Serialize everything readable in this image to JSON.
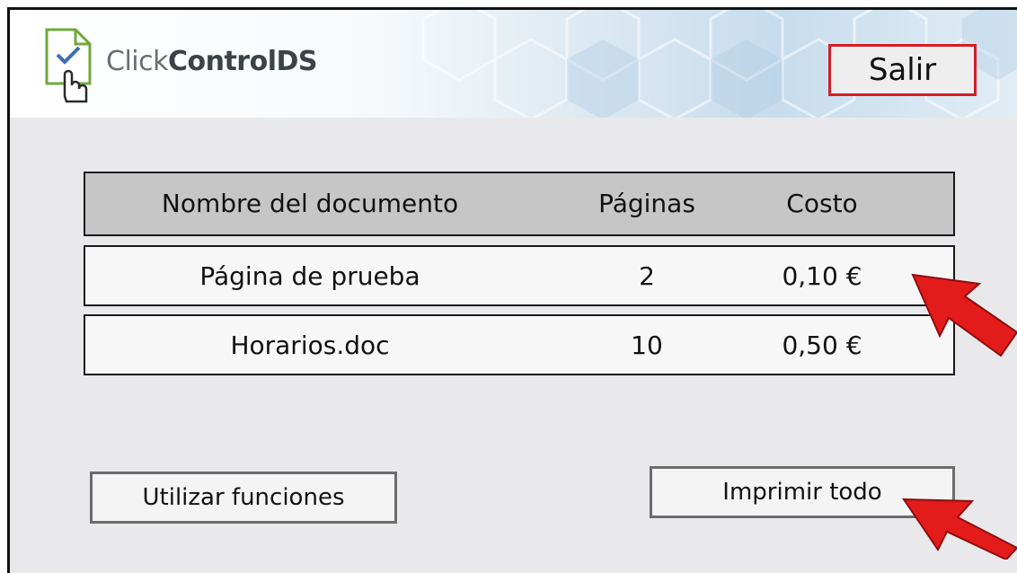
{
  "app": {
    "brand_light": "Click",
    "brand_bold": "ControlDS"
  },
  "header": {
    "exit_label": "Salir"
  },
  "table": {
    "headers": [
      "Nombre del documento",
      "Páginas",
      "Costo"
    ],
    "rows": [
      {
        "name": "Página de prueba",
        "pages": "2",
        "cost": "0,10 €"
      },
      {
        "name": "Horarios.doc",
        "pages": "10",
        "cost": "0,50 €"
      }
    ]
  },
  "actions": {
    "utilities_label": "Utilizar funciones",
    "print_all_label": "Imprimir todo"
  },
  "colors": {
    "exit_border": "#d21f25",
    "arrow": "#e41b1b",
    "header_row": "#c6c6c6",
    "panel": "#e9e9eb"
  },
  "icons": [
    "document-check-icon",
    "hand-pointer-icon",
    "red-arrow-icon"
  ]
}
